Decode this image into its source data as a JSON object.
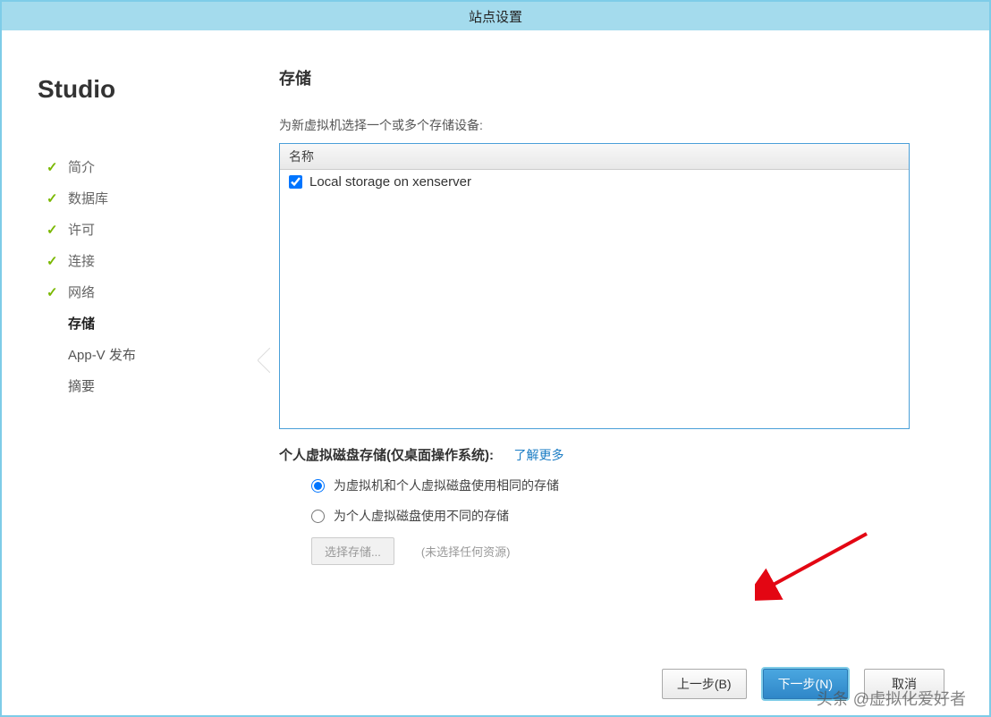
{
  "window": {
    "title": "站点设置"
  },
  "sidebar": {
    "brand": "Studio",
    "steps": [
      {
        "label": "简介",
        "done": true
      },
      {
        "label": "数据库",
        "done": true
      },
      {
        "label": "许可",
        "done": true
      },
      {
        "label": "连接",
        "done": true
      },
      {
        "label": "网络",
        "done": true
      },
      {
        "label": "存储",
        "current": true
      },
      {
        "label": "App-V 发布",
        "future": true
      },
      {
        "label": "摘要",
        "future": true
      }
    ]
  },
  "main": {
    "heading": "存储",
    "instruction": "为新虚拟机选择一个或多个存储设备:",
    "table": {
      "header": "名称",
      "rows": [
        {
          "label": "Local storage on xenserver",
          "checked": true
        }
      ]
    },
    "pvd": {
      "label": "个人虚拟磁盘存储(仅桌面操作系统):",
      "link": "了解更多",
      "options": [
        {
          "label": "为虚拟机和个人虚拟磁盘使用相同的存储",
          "selected": true
        },
        {
          "label": "为个人虚拟磁盘使用不同的存储",
          "selected": false
        }
      ],
      "selectBtn": "选择存储...",
      "hint": "(未选择任何资源)"
    }
  },
  "footer": {
    "back": "上一步(B)",
    "next": "下一步(N)",
    "cancel": "取消"
  },
  "watermark": "头条 @虚拟化爱好者"
}
